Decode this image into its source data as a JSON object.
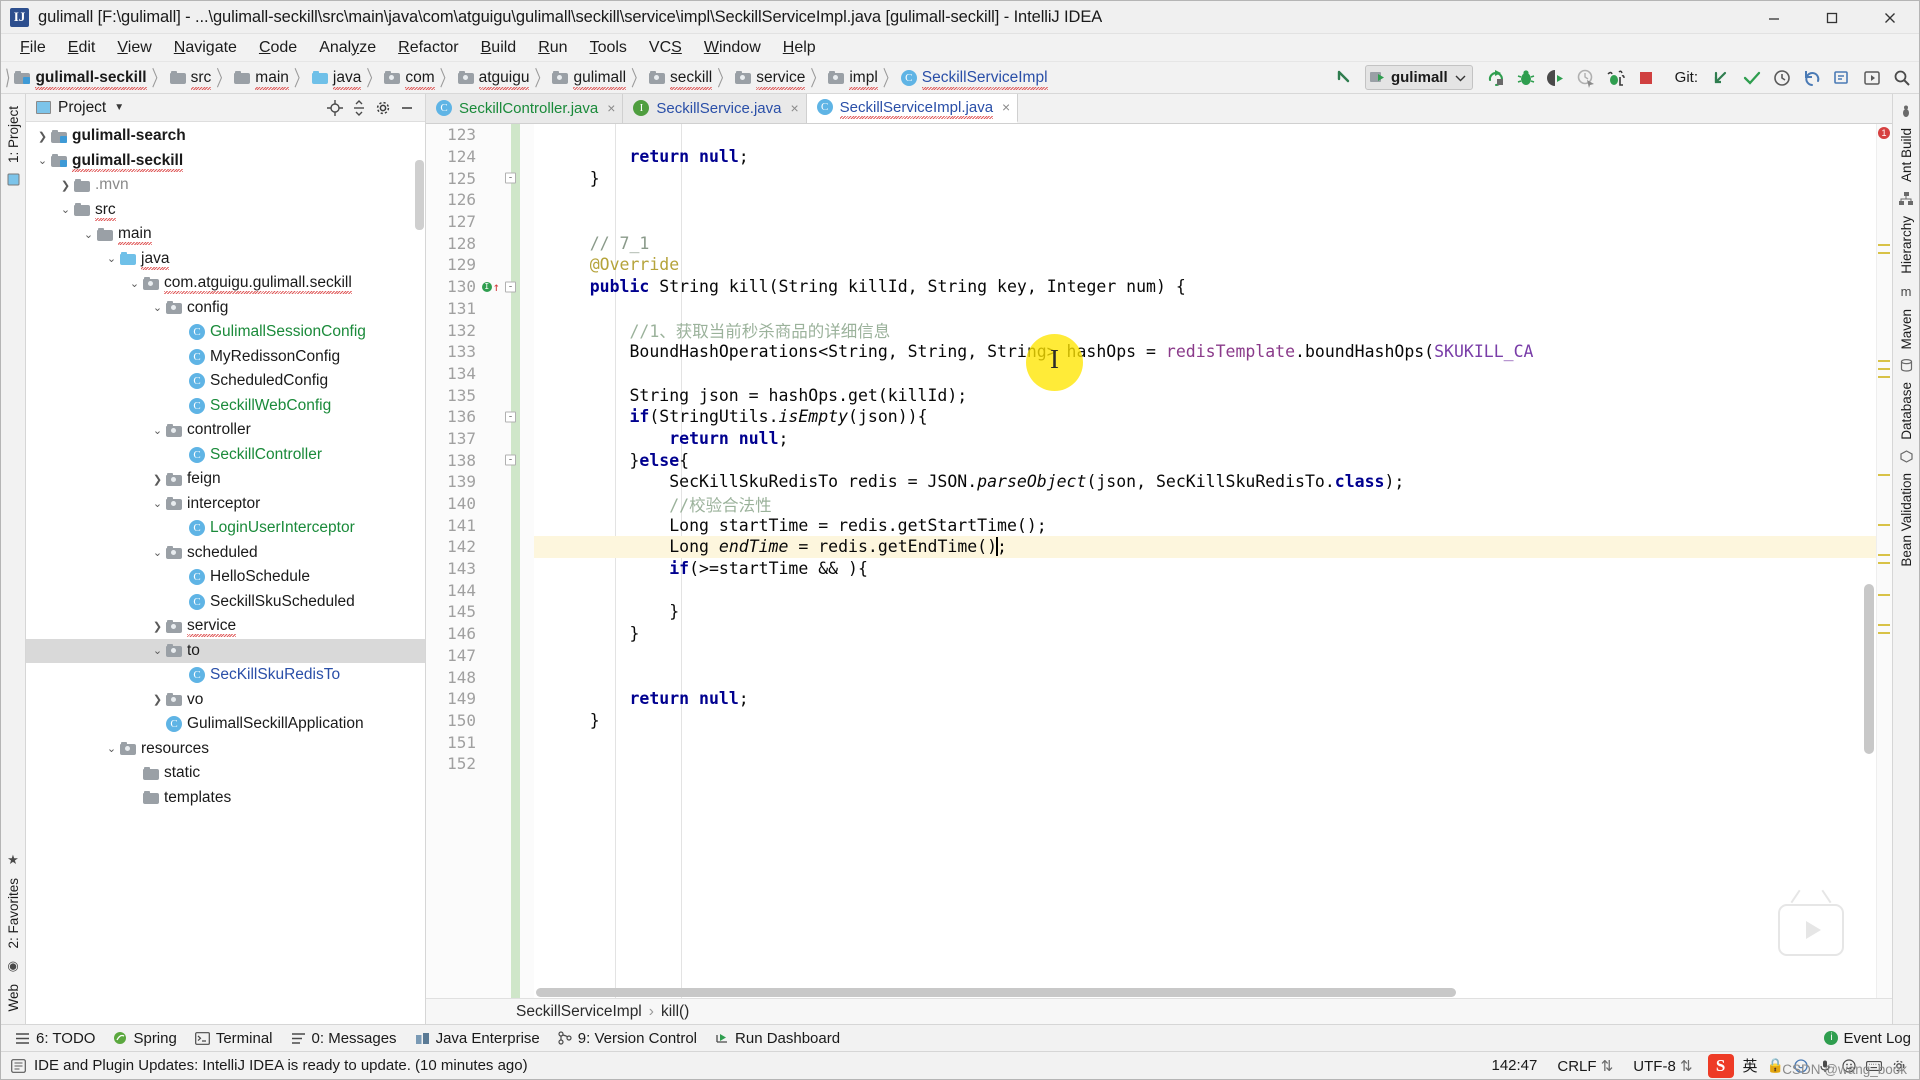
{
  "window": {
    "title": "gulimall [F:\\gulimall] - ...\\gulimall-seckill\\src\\main\\java\\com\\atguigu\\gulimall\\seckill\\service\\impl\\SeckillServiceImpl.java [gulimall-seckill] - IntelliJ IDEA",
    "logo": "IJ",
    "minimize": "minimize-icon",
    "maximize": "maximize-icon",
    "close": "close-icon"
  },
  "menubar": {
    "items": [
      {
        "label": "File"
      },
      {
        "label": "Edit"
      },
      {
        "label": "View"
      },
      {
        "label": "Navigate"
      },
      {
        "label": "Code"
      },
      {
        "label": "Analyze"
      },
      {
        "label": "Refactor"
      },
      {
        "label": "Build"
      },
      {
        "label": "Run"
      },
      {
        "label": "Tools"
      },
      {
        "label": "VCS"
      },
      {
        "label": "Window"
      },
      {
        "label": "Help"
      }
    ]
  },
  "navbar": {
    "crumbs": [
      {
        "label": "gulimall-seckill",
        "kind": "module",
        "bold": true,
        "squiggly": true
      },
      {
        "label": "src",
        "kind": "folder",
        "squiggly": true
      },
      {
        "label": "main",
        "kind": "folder",
        "squiggly": true
      },
      {
        "label": "java",
        "kind": "source",
        "squiggly": true
      },
      {
        "label": "com",
        "kind": "package",
        "squiggly": true
      },
      {
        "label": "atguigu",
        "kind": "package",
        "squiggly": true
      },
      {
        "label": "gulimall",
        "kind": "package",
        "squiggly": true
      },
      {
        "label": "seckill",
        "kind": "package",
        "squiggly": true
      },
      {
        "label": "service",
        "kind": "package",
        "squiggly": true
      },
      {
        "label": "impl",
        "kind": "package",
        "squiggly": true
      },
      {
        "label": "SeckillServiceImpl",
        "kind": "class",
        "link": true,
        "squiggly": true
      }
    ],
    "separator": "〉",
    "run_config": "gulimall",
    "git_label": "Git:",
    "tools": [
      "back-arrow-icon",
      "rerun-icon",
      "debug-icon",
      "run-with-coverage-icon",
      "profile-icon",
      "attach-process-icon",
      "stop-icon",
      "git-update-icon",
      "git-commit-icon",
      "git-history-icon",
      "git-revert-icon",
      "search-everywhere-icon",
      "settings-icon",
      "find-icon"
    ]
  },
  "left_rail": {
    "top": [
      "1: Project",
      "structure-icon"
    ],
    "bottom": [
      "2: Favorites",
      "Web"
    ]
  },
  "right_rail": {
    "items": [
      "Ant Build",
      "Hierarchy",
      "Maven",
      "Database",
      "Bean Validation"
    ]
  },
  "project_panel": {
    "title": "Project",
    "header_icons": [
      "locate-icon",
      "collapse-all-icon",
      "settings-icon",
      "hide-icon"
    ],
    "tree": [
      {
        "label": "gulimall-search",
        "indent": 1,
        "arrow": "collapsed",
        "icon": "module",
        "bold": true,
        "color": "default"
      },
      {
        "label": "gulimall-seckill",
        "indent": 1,
        "arrow": "expanded",
        "icon": "module",
        "bold": true,
        "color": "default",
        "squiggly": true
      },
      {
        "label": ".mvn",
        "indent": 2,
        "arrow": "collapsed",
        "icon": "folder",
        "color": "grey"
      },
      {
        "label": "src",
        "indent": 2,
        "arrow": "expanded",
        "icon": "folder",
        "color": "default",
        "squiggly": true
      },
      {
        "label": "main",
        "indent": 3,
        "arrow": "expanded",
        "icon": "folder",
        "color": "default",
        "squiggly": true
      },
      {
        "label": "java",
        "indent": 4,
        "arrow": "expanded",
        "icon": "source",
        "color": "default",
        "squiggly": true
      },
      {
        "label": "com.atguigu.gulimall.seckill",
        "indent": 5,
        "arrow": "expanded",
        "icon": "package",
        "color": "default",
        "squiggly": true
      },
      {
        "label": "config",
        "indent": 6,
        "arrow": "expanded",
        "icon": "package",
        "color": "default"
      },
      {
        "label": "GulimallSessionConfig",
        "indent": 7,
        "arrow": "none",
        "icon": "class",
        "color": "green"
      },
      {
        "label": "MyRedissonConfig",
        "indent": 7,
        "arrow": "none",
        "icon": "class",
        "color": "default"
      },
      {
        "label": "ScheduledConfig",
        "indent": 7,
        "arrow": "none",
        "icon": "class",
        "color": "default"
      },
      {
        "label": "SeckillWebConfig",
        "indent": 7,
        "arrow": "none",
        "icon": "class",
        "color": "green"
      },
      {
        "label": "controller",
        "indent": 6,
        "arrow": "expanded",
        "icon": "package",
        "color": "default"
      },
      {
        "label": "SeckillController",
        "indent": 7,
        "arrow": "none",
        "icon": "class",
        "color": "green"
      },
      {
        "label": "feign",
        "indent": 6,
        "arrow": "collapsed",
        "icon": "package",
        "color": "default"
      },
      {
        "label": "interceptor",
        "indent": 6,
        "arrow": "expanded",
        "icon": "package",
        "color": "default"
      },
      {
        "label": "LoginUserInterceptor",
        "indent": 7,
        "arrow": "none",
        "icon": "class",
        "color": "green"
      },
      {
        "label": "scheduled",
        "indent": 6,
        "arrow": "expanded",
        "icon": "package",
        "color": "default"
      },
      {
        "label": "HelloSchedule",
        "indent": 7,
        "arrow": "none",
        "icon": "class",
        "color": "default"
      },
      {
        "label": "SeckillSkuScheduled",
        "indent": 7,
        "arrow": "none",
        "icon": "class",
        "color": "default"
      },
      {
        "label": "service",
        "indent": 6,
        "arrow": "collapsed",
        "icon": "package",
        "color": "default",
        "squiggly": true
      },
      {
        "label": "to",
        "indent": 6,
        "arrow": "expanded",
        "icon": "package",
        "color": "default",
        "selected": true
      },
      {
        "label": "SecKillSkuRedisTo",
        "indent": 7,
        "arrow": "none",
        "icon": "class",
        "color": "blue"
      },
      {
        "label": "vo",
        "indent": 6,
        "arrow": "collapsed",
        "icon": "package",
        "color": "default"
      },
      {
        "label": "GulimallSeckillApplication",
        "indent": 6,
        "arrow": "none",
        "icon": "spring-class",
        "color": "default"
      },
      {
        "label": "resources",
        "indent": 4,
        "arrow": "expanded",
        "icon": "resource-folder",
        "color": "default"
      },
      {
        "label": "static",
        "indent": 5,
        "arrow": "none",
        "icon": "folder",
        "color": "default"
      },
      {
        "label": "templates",
        "indent": 5,
        "arrow": "none",
        "icon": "folder",
        "color": "default"
      }
    ]
  },
  "editor": {
    "tabs": [
      {
        "label": "SeckillController.java",
        "icon": "class",
        "color": "green",
        "active": false,
        "close": "×"
      },
      {
        "label": "SeckillService.java",
        "icon": "interface",
        "color": "blue",
        "active": false,
        "close": "×"
      },
      {
        "label": "SeckillServiceImpl.java",
        "icon": "class",
        "color": "blue",
        "active": true,
        "squiggly": true,
        "close": "×"
      }
    ],
    "first_line": 123,
    "lines": [
      {
        "n": 123,
        "segs": []
      },
      {
        "n": 124,
        "segs": [
          {
            "t": "        ",
            "c": ""
          },
          {
            "t": "return",
            "c": "kw"
          },
          {
            "t": " ",
            "c": ""
          },
          {
            "t": "null",
            "c": "kw"
          },
          {
            "t": ";",
            "c": ""
          }
        ]
      },
      {
        "n": 125,
        "segs": [
          {
            "t": "    }",
            "c": ""
          }
        ],
        "fold": "-"
      },
      {
        "n": 126,
        "segs": []
      },
      {
        "n": 127,
        "segs": []
      },
      {
        "n": 128,
        "segs": [
          {
            "t": "    // 7_1",
            "c": "cm"
          }
        ]
      },
      {
        "n": 129,
        "segs": [
          {
            "t": "    @Override",
            "c": "ann"
          }
        ]
      },
      {
        "n": 130,
        "segs": [
          {
            "t": "    ",
            "c": ""
          },
          {
            "t": "public",
            "c": "kw"
          },
          {
            "t": " String kill(String killId, String key, Integer num) {",
            "c": ""
          }
        ],
        "fold": "-",
        "gutter_marks": true
      },
      {
        "n": 131,
        "segs": []
      },
      {
        "n": 132,
        "segs": [
          {
            "t": "        //1、获取当前秒杀商品的详细信息",
            "c": "cmz"
          }
        ]
      },
      {
        "n": 133,
        "segs": [
          {
            "t": "        BoundHashOperations<String, String, String> hashOps = ",
            "c": ""
          },
          {
            "t": "redisTemplate",
            "c": "fld"
          },
          {
            "t": ".boundHashOps(",
            "c": ""
          },
          {
            "t": "SKUKILL_CA",
            "c": "fl"
          }
        ]
      },
      {
        "n": 134,
        "segs": []
      },
      {
        "n": 135,
        "segs": [
          {
            "t": "        String json = hashOps.get(killId);",
            "c": ""
          }
        ]
      },
      {
        "n": 136,
        "segs": [
          {
            "t": "        ",
            "c": ""
          },
          {
            "t": "if",
            "c": "kw"
          },
          {
            "t": "(StringUtils.",
            "c": ""
          },
          {
            "t": "isEmpty",
            "c": "ital"
          },
          {
            "t": "(json)){",
            "c": ""
          }
        ],
        "fold": "-"
      },
      {
        "n": 137,
        "segs": [
          {
            "t": "            ",
            "c": ""
          },
          {
            "t": "return",
            "c": "kw"
          },
          {
            "t": " ",
            "c": ""
          },
          {
            "t": "null",
            "c": "kw"
          },
          {
            "t": ";",
            "c": ""
          }
        ]
      },
      {
        "n": 138,
        "segs": [
          {
            "t": "        }",
            "c": ""
          },
          {
            "t": "else",
            "c": "kw"
          },
          {
            "t": "{",
            "c": ""
          }
        ],
        "fold": "-"
      },
      {
        "n": 139,
        "segs": [
          {
            "t": "            SecKillSkuRedisTo redis = JSON.",
            "c": ""
          },
          {
            "t": "parseObject",
            "c": "ital"
          },
          {
            "t": "(json, SecKillSkuRedisTo.",
            "c": ""
          },
          {
            "t": "class",
            "c": "kw"
          },
          {
            "t": ");",
            "c": ""
          }
        ]
      },
      {
        "n": 140,
        "segs": [
          {
            "t": "            //校验合法性",
            "c": "cmz"
          }
        ]
      },
      {
        "n": 141,
        "segs": [
          {
            "t": "            Long startTime = redis.getStartTime();",
            "c": ""
          }
        ]
      },
      {
        "n": 142,
        "segs": [
          {
            "t": "            ",
            "c": ""
          },
          {
            "t": "Long ",
            "c": ""
          },
          {
            "t": "endTime",
            "c": "ital"
          },
          {
            "t": " = redis.getEndTime();",
            "c": ""
          }
        ],
        "highlight": true
      },
      {
        "n": 143,
        "segs": [
          {
            "t": "            ",
            "c": ""
          },
          {
            "t": "if",
            "c": "kw"
          },
          {
            "t": "(>=startTime && ){",
            "c": ""
          }
        ]
      },
      {
        "n": 144,
        "segs": []
      },
      {
        "n": 145,
        "segs": [
          {
            "t": "            }",
            "c": ""
          }
        ]
      },
      {
        "n": 146,
        "segs": [
          {
            "t": "        }",
            "c": ""
          }
        ]
      },
      {
        "n": 147,
        "segs": []
      },
      {
        "n": 148,
        "segs": []
      },
      {
        "n": 149,
        "segs": [
          {
            "t": "        ",
            "c": ""
          },
          {
            "t": "return",
            "c": "kw"
          },
          {
            "t": " ",
            "c": ""
          },
          {
            "t": "null",
            "c": "kw"
          },
          {
            "t": ";",
            "c": ""
          }
        ]
      },
      {
        "n": 150,
        "segs": [
          {
            "t": "    }",
            "c": ""
          }
        ]
      },
      {
        "n": 151,
        "segs": []
      },
      {
        "n": 152,
        "segs": []
      }
    ],
    "breadcrumb": {
      "file": "SeckillServiceImpl",
      "member": "kill()",
      "sep": "›"
    },
    "error_count": "1"
  },
  "tool_windows": [
    {
      "label": "6: TODO",
      "icon": "todo-icon",
      "accel": "6"
    },
    {
      "label": "Spring",
      "icon": "spring-icon"
    },
    {
      "label": "Terminal",
      "icon": "terminal-icon"
    },
    {
      "label": "0: Messages",
      "icon": "messages-icon",
      "accel": "0"
    },
    {
      "label": "Java Enterprise",
      "icon": "java-enterprise-icon"
    },
    {
      "label": "9: Version Control",
      "icon": "version-control-icon",
      "accel": "9"
    },
    {
      "label": "Run Dashboard",
      "icon": "run-dashboard-icon"
    },
    {
      "label": "Event Log",
      "icon": "event-log-icon"
    }
  ],
  "statusbar": {
    "message": "IDE and Plugin Updates: IntelliJ IDEA is ready to update. (10 minutes ago)",
    "caret_position": "142:47",
    "line_separator": "CRLF",
    "encoding": "UTF-8",
    "ime_app": "S",
    "ime_mode": "英",
    "icons": [
      "lock-icon",
      "notification-icon",
      "microphone-icon",
      "smiley-icon",
      "keyboard-icon",
      "settings-icon"
    ],
    "watermark": "CSDN @wang_book"
  },
  "colors": {
    "accent_green": "#1a8a3a",
    "accent_blue": "#2a4fa8",
    "keyword": "#00008f",
    "comment": "#8a9a8a",
    "annotation": "#b5a33a",
    "highlight_line": "#fdf6dd",
    "cursor_highlight": "#ffe500",
    "error_red": "#d64040",
    "chrome": "#f2f2f2"
  }
}
